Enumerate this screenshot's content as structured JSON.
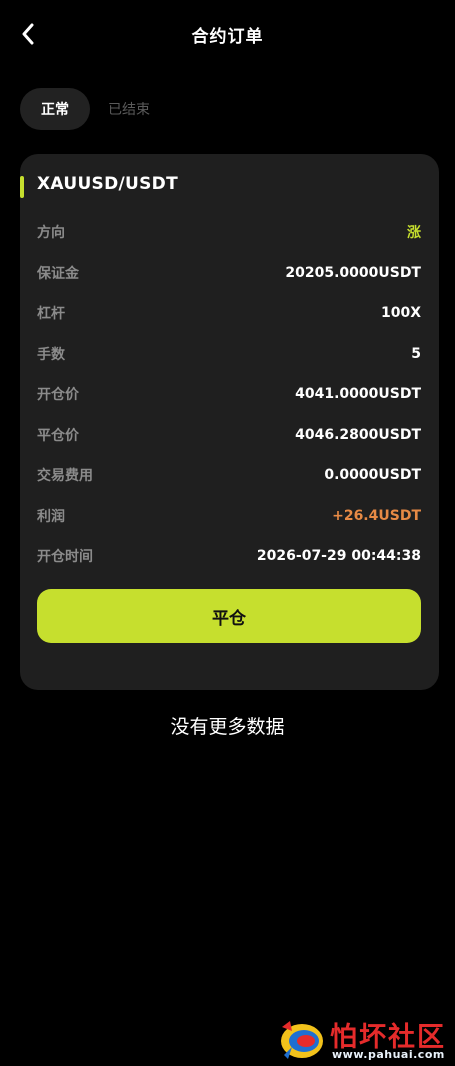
{
  "header": {
    "title": "合约订单",
    "back_icon": "chevron-left-icon"
  },
  "tabs": [
    {
      "label": "正常",
      "active": true
    },
    {
      "label": "已结束",
      "active": false
    }
  ],
  "order": {
    "symbol": "XAUUSD/USDT",
    "accent_color": "#c6df2e",
    "rows": [
      {
        "label": "方向",
        "value": "涨"
      },
      {
        "label": "保证金",
        "value": "20205.0000USDT"
      },
      {
        "label": "杠杆",
        "value": "100X"
      },
      {
        "label": "手数",
        "value": "5"
      },
      {
        "label": "开仓价",
        "value": "4041.0000USDT"
      },
      {
        "label": "平仓价",
        "value": "4046.2800USDT"
      },
      {
        "label": "交易费用",
        "value": "0.0000USDT"
      },
      {
        "label": "利润",
        "value": "+26.4USDT"
      },
      {
        "label": "开仓时间",
        "value": "2026-07-29 00:44:38"
      }
    ],
    "close_button": "平仓"
  },
  "footer": {
    "no_more": "没有更多数据"
  },
  "watermark": {
    "title": "怕坏社区",
    "url": "www.pahuai.com"
  },
  "colors": {
    "background": "#000000",
    "card": "#1f1f1f",
    "up": "#c6df2e",
    "profit": "#e78a45",
    "label": "#8b8b8b"
  }
}
